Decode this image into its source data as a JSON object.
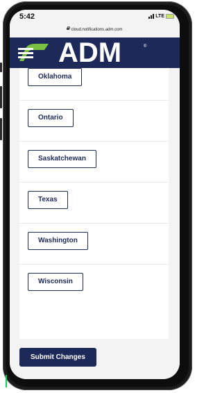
{
  "status_bar": {
    "time": "5:42",
    "network": "LTE",
    "battery_color": "#c8e26b"
  },
  "browser": {
    "url": "cloud.notifications.adm.com"
  },
  "header": {
    "logo_text": "ADM",
    "logo_mark": "®",
    "background": "#1d2a59",
    "accent_green": "#7ac142"
  },
  "states": [
    {
      "label": "Oklahoma"
    },
    {
      "label": "Ontario"
    },
    {
      "label": "Saskatchewan"
    },
    {
      "label": "Texas"
    },
    {
      "label": "Washington"
    },
    {
      "label": "Wisconsin"
    }
  ],
  "actions": {
    "submit_label": "Submit Changes"
  }
}
